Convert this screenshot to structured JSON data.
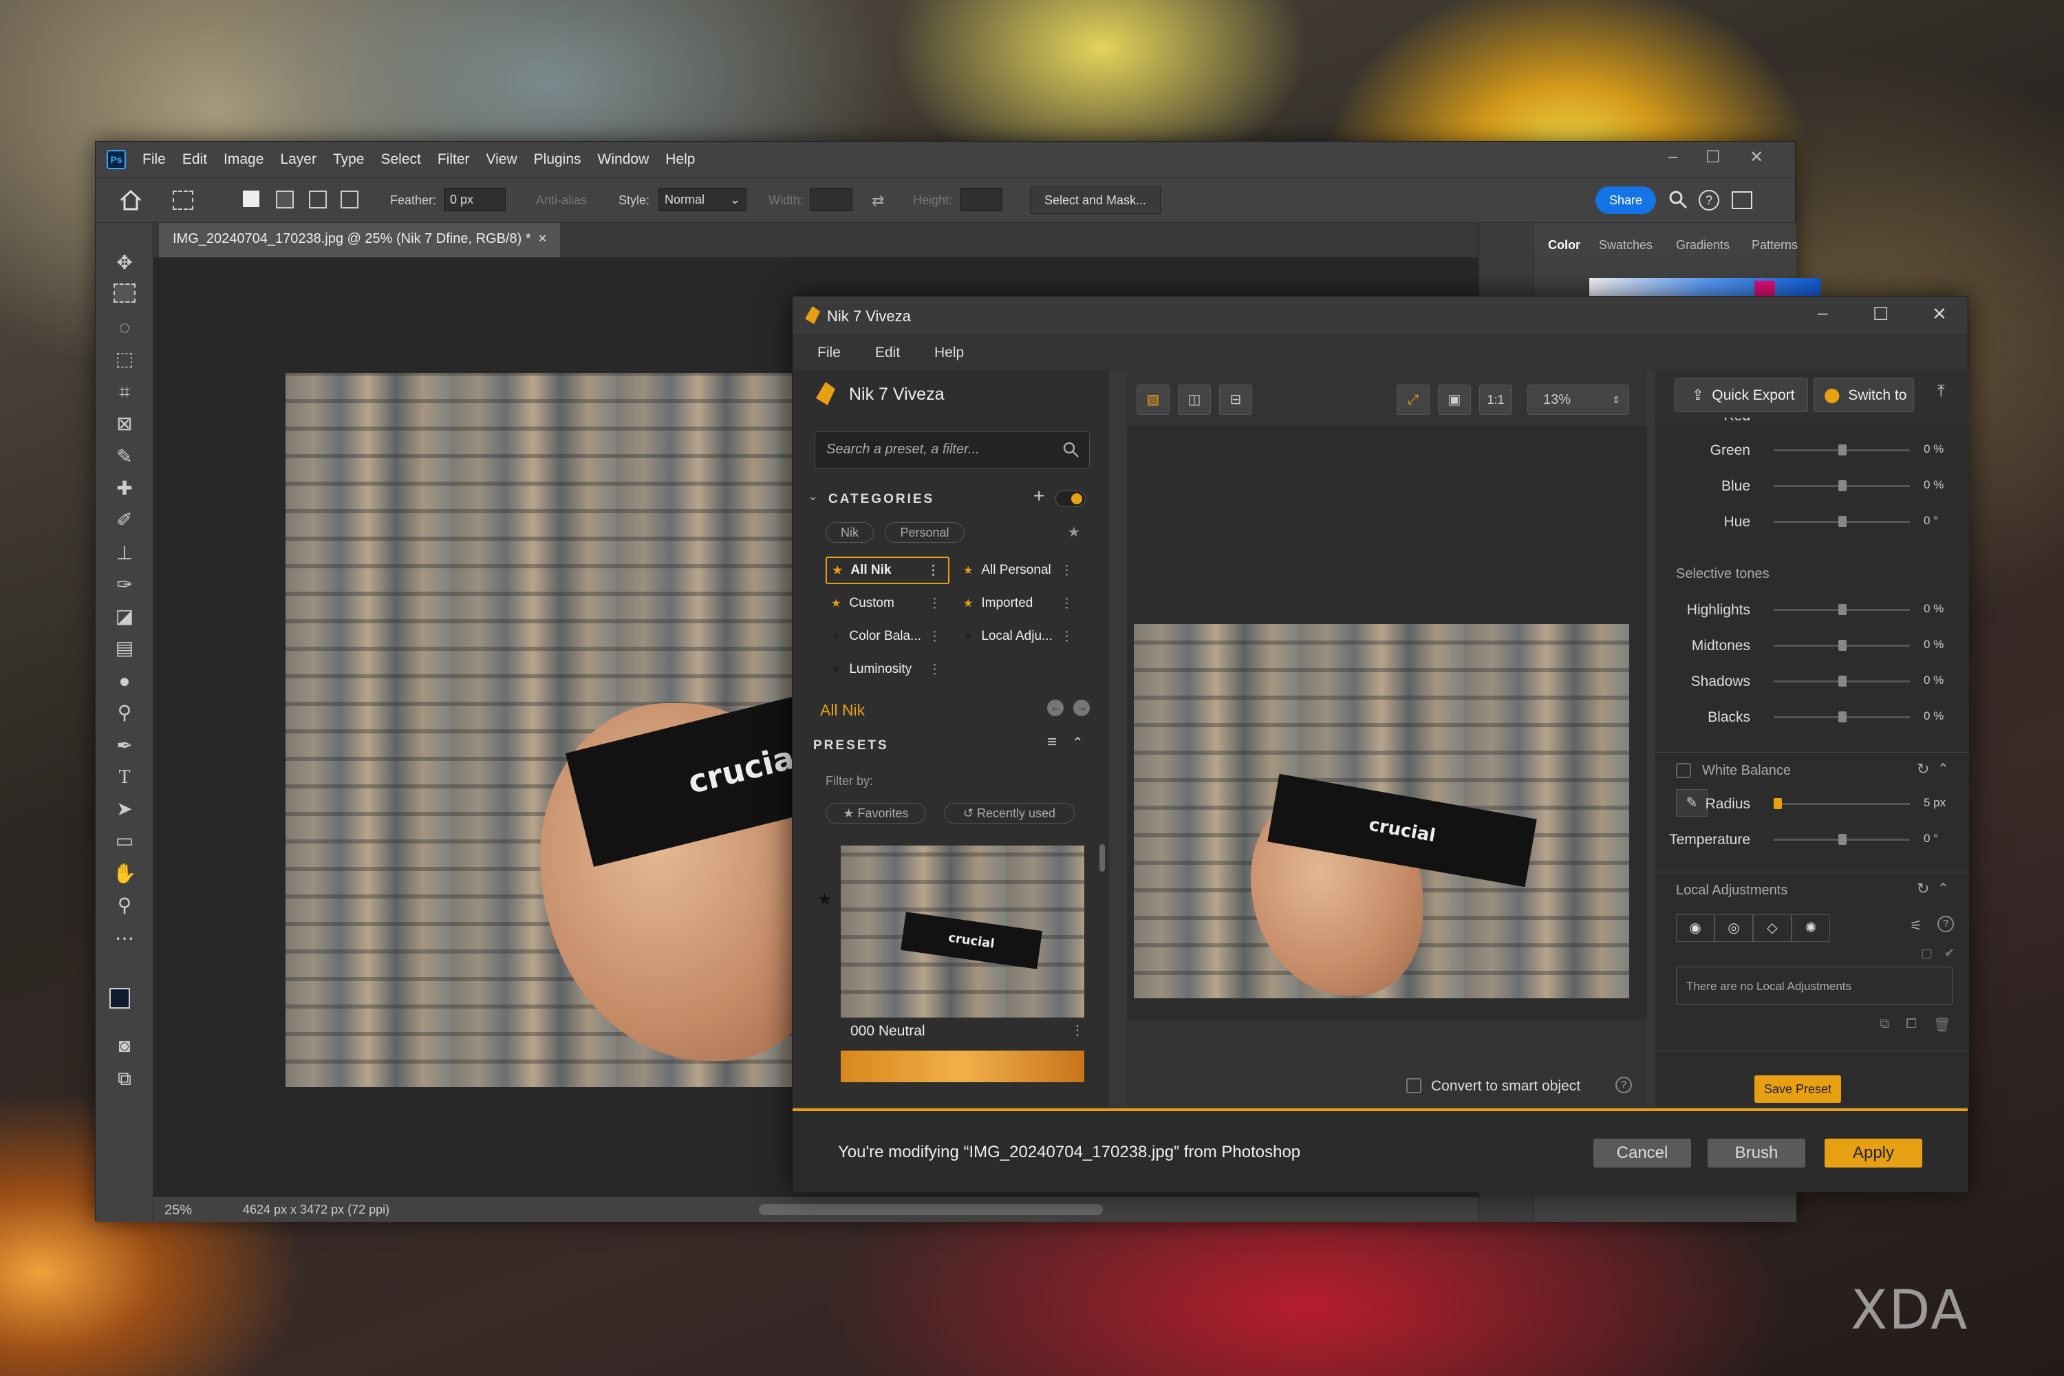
{
  "photoshop": {
    "logo": "Ps",
    "menu": [
      "File",
      "Edit",
      "Image",
      "Layer",
      "Type",
      "Select",
      "Filter",
      "View",
      "Plugins",
      "Window",
      "Help"
    ],
    "window_controls": {
      "minimize": "–",
      "maximize": "☐",
      "close": "✕"
    },
    "options": {
      "feather_label": "Feather:",
      "feather_value": "0 px",
      "anti_alias": "Anti-alias",
      "style_label": "Style:",
      "style_value": "Normal",
      "width_label": "Width:",
      "height_label": "Height:",
      "select_mask": "Select and Mask...",
      "share": "Share"
    },
    "doc_tab": "IMG_20240704_170238.jpg @ 25% (Nik 7 Dfine, RGB/8) *",
    "doc_tab_close": "×",
    "panel_tabs": [
      "Color",
      "Swatches",
      "Gradients",
      "Patterns"
    ],
    "status": {
      "zoom": "25%",
      "dimensions": "4624 px x 3472 px (72 ppi)"
    }
  },
  "nik": {
    "window_title": "Nik 7 Viveza",
    "menu": [
      "File",
      "Edit",
      "Help"
    ],
    "app_title": "Nik 7 Viveza",
    "search_placeholder": "Search a preset, a filter...",
    "categories_heading": "CATEGORIES",
    "category_pills": [
      "Nik",
      "Personal"
    ],
    "categories": [
      {
        "label": "All Nik",
        "selected": true
      },
      {
        "label": "All Personal",
        "selected": false
      },
      {
        "label": "Custom",
        "selected": false
      },
      {
        "label": "Imported",
        "selected": false
      },
      {
        "label": "Color Bala...",
        "selected": false
      },
      {
        "label": "Local Adju...",
        "selected": false
      },
      {
        "label": "Luminosity",
        "selected": false
      }
    ],
    "current_category": "All Nik",
    "presets_heading": "PRESETS",
    "filter_by": "Filter by:",
    "filter_pills": [
      "Favorites",
      "Recently used"
    ],
    "preset_name": "000 Neutral",
    "zoom_level": "13%",
    "one_to_one": "1:1",
    "quick_export": "Quick Export",
    "switch_to": "Switch to",
    "adjustments": {
      "partial_top": "Red",
      "rows_top": [
        {
          "label": "Green",
          "value": "0 %"
        },
        {
          "label": "Blue",
          "value": "0 %"
        },
        {
          "label": "Hue",
          "value": "0 °"
        }
      ],
      "selective_tones": "Selective tones",
      "tones": [
        {
          "label": "Highlights",
          "value": "0 %"
        },
        {
          "label": "Midtones",
          "value": "0 %"
        },
        {
          "label": "Shadows",
          "value": "0 %"
        },
        {
          "label": "Blacks",
          "value": "0 %"
        }
      ],
      "white_balance": "White Balance",
      "radius": {
        "label": "Radius",
        "value": "5 px"
      },
      "temperature": {
        "label": "Temperature",
        "value": "0 °"
      },
      "local_adjustments": "Local Adjustments",
      "no_local": "There are no Local Adjustments"
    },
    "convert_smart": "Convert to smart object",
    "save_preset": "Save Preset",
    "modifying": "You're modifying “IMG_20240704_170238.jpg” from Photoshop",
    "buttons": {
      "cancel": "Cancel",
      "brush": "Brush",
      "apply": "Apply"
    }
  },
  "watermark": "XDA",
  "colors": {
    "accent": "#e8a013",
    "ps_blue": "#1473e6"
  }
}
